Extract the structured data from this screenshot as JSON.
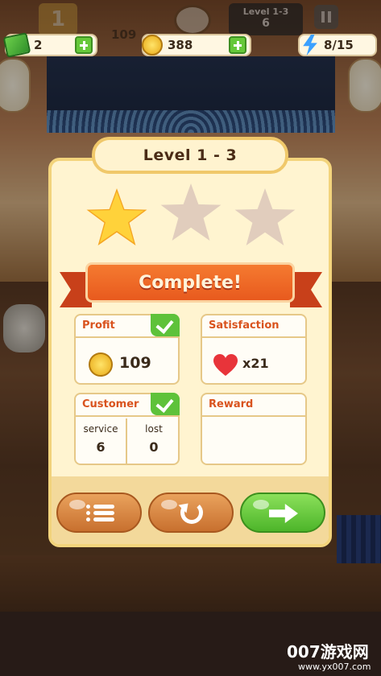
{
  "hud": {
    "player_level": "1",
    "score": "109",
    "level_label": "Level 1-3",
    "level_progress": "6",
    "cash": "2",
    "coins": "388",
    "energy": "8/15"
  },
  "dialog": {
    "title": "Level 1 - 3",
    "stars_earned": 1,
    "stars_total": 3,
    "banner": "Complete!",
    "profit": {
      "label": "Profit",
      "value": "109",
      "icon": "coin-icon",
      "achieved": true
    },
    "satisfaction": {
      "label": "Satisfaction",
      "value": "x21",
      "icon": "heart-icon"
    },
    "customer": {
      "label": "Customer",
      "achieved": true,
      "service_label": "service",
      "service_value": "6",
      "lost_label": "lost",
      "lost_value": "0"
    },
    "reward": {
      "label": "Reward"
    }
  },
  "buttons": {
    "list_icon": "list-icon",
    "retry_icon": "retry-icon",
    "next_icon": "arrow-right-icon"
  },
  "watermark": {
    "text": "007游戏网",
    "url": "www.yx007.com"
  },
  "colors": {
    "accent_orange": "#e85a1e",
    "success_green": "#5ec23a",
    "gold_star": "#ffd23a",
    "empty_star": "#e1cdbd",
    "panel": "#fff4d0"
  }
}
